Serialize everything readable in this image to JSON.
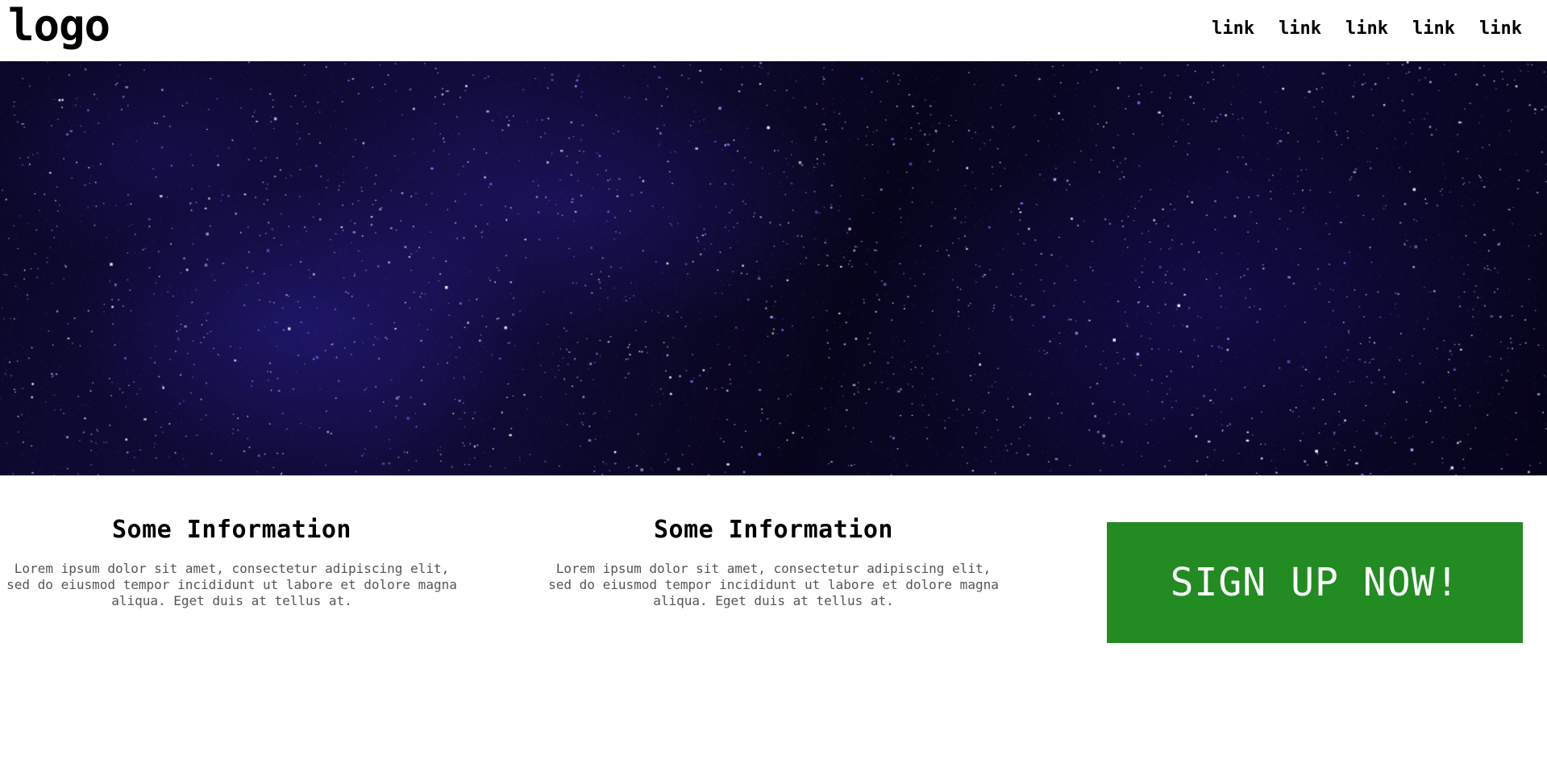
{
  "header": {
    "logo": "logo",
    "nav": [
      "link",
      "link",
      "link",
      "link",
      "link"
    ]
  },
  "hero": {
    "image": "starry-night-sky"
  },
  "info_blocks": [
    {
      "title": "Some Information",
      "text": "Lorem ipsum dolor sit amet, consectetur adipiscing elit, sed do eiusmod tempor incididunt ut labore et dolore magna aliqua. Eget duis at tellus at."
    },
    {
      "title": "Some Information",
      "text": "Lorem ipsum dolor sit amet, consectetur adipiscing elit, sed do eiusmod tempor incididunt ut labore et dolore magna aliqua. Eget duis at tellus at."
    }
  ],
  "cta": {
    "label": "SIGN UP NOW!"
  },
  "colors": {
    "cta_background": "#228b22",
    "hero_base": "#0a0728",
    "text": "#000000",
    "body_text": "#555555"
  }
}
